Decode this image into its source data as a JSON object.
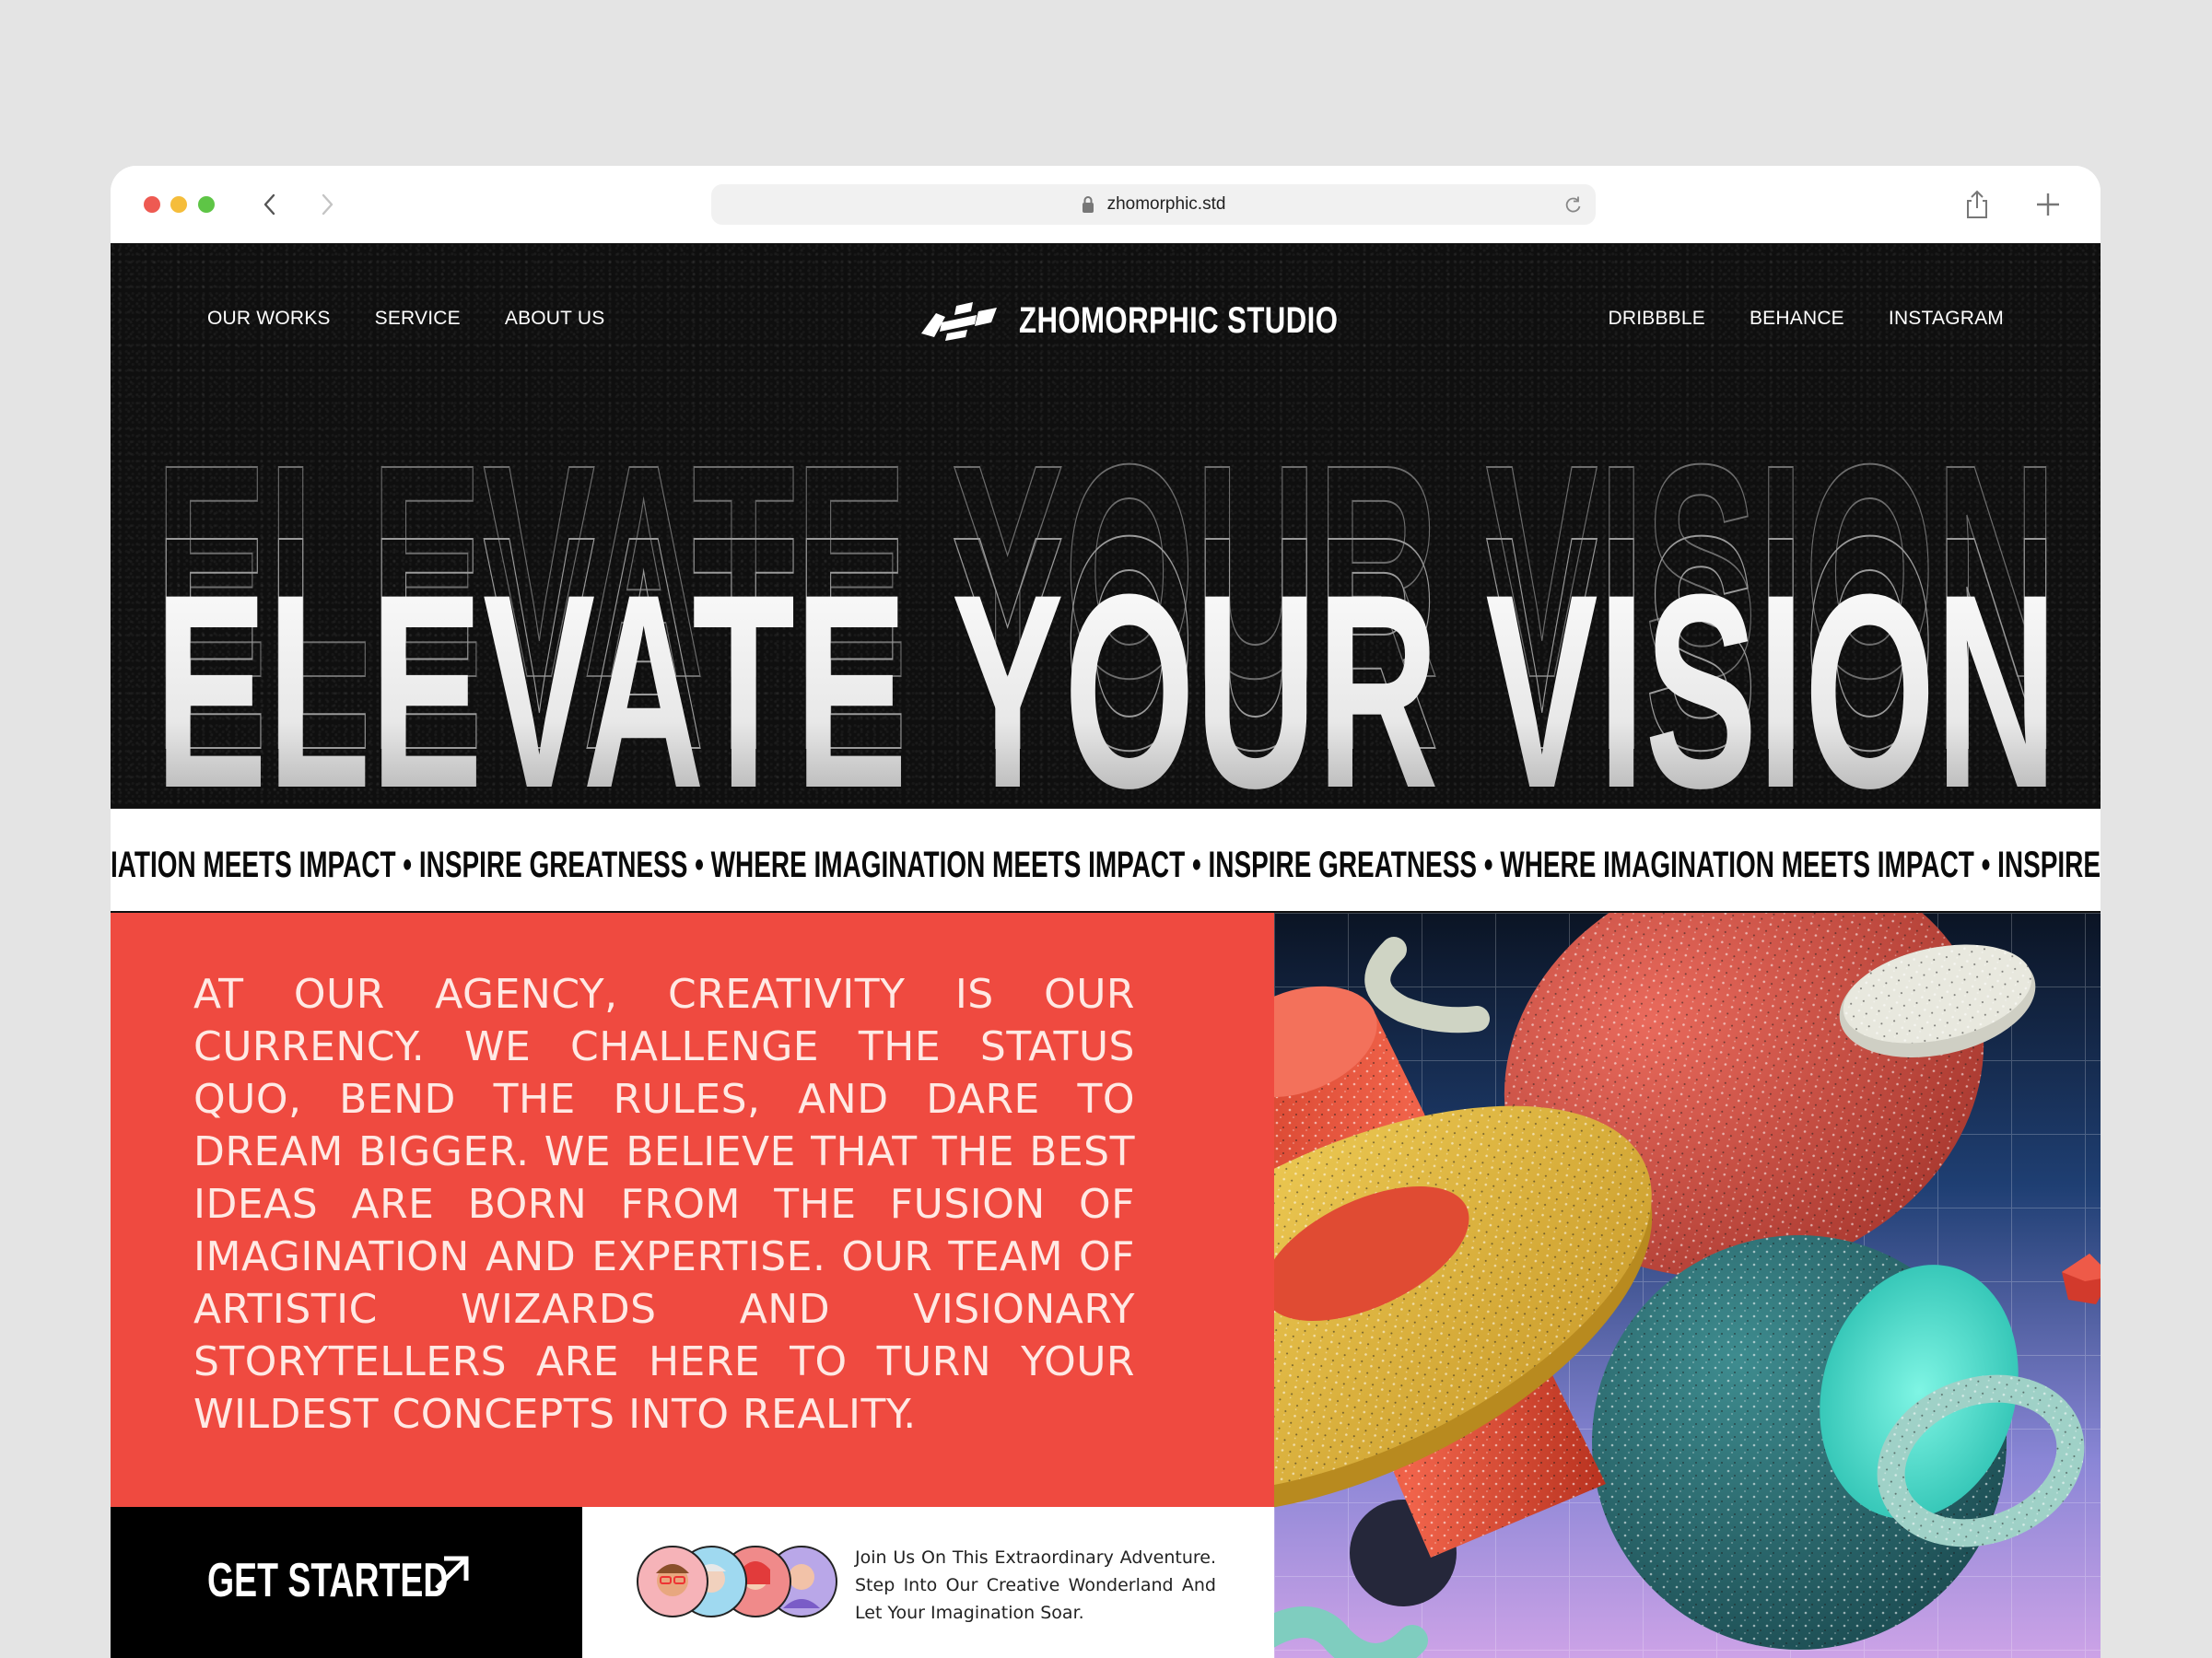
{
  "browser": {
    "url": "zhomorphic.std"
  },
  "nav": {
    "left": [
      "OUR WORKS",
      "SERVICE",
      "ABOUT US"
    ],
    "brand": "ZHOMORPHIC STUDIO",
    "right": [
      "DRIBBBLE",
      "BEHANCE",
      "INSTAGRAM"
    ]
  },
  "hero": {
    "headline": "ELEVATE YOUR VISION"
  },
  "marquee": {
    "text": "IATION MEETS IMPACT  •  INSPIRE GREATNESS  •  WHERE IMAGINATION MEETS IMPACT  •  INSPIRE GREATNESS  •  WHERE IMAGINATION MEETS IMPACT  •  INSPIRE"
  },
  "about": {
    "mission": "AT OUR AGENCY, CREATIVITY IS OUR CURRENCY. WE CHALLENGE THE STATUS QUO, BEND THE RULES, AND DARE TO DREAM BIGGER. WE BELIEVE THAT THE BEST IDEAS ARE BORN FROM THE FUSION OF IMAGINATION AND EXPERTISE. OUR TEAM OF ARTISTIC WIZARDS AND VISIONARY STORYTELLERS ARE HERE TO TURN YOUR WILDEST CONCEPTS INTO REALITY."
  },
  "cta": {
    "label": "GET STARTED",
    "join_text": "Join Us On This Extraordinary Adventure. Step Into Our Creative Wonderland And Let Your Imagination Soar."
  },
  "colors": {
    "accent_red": "#ef4a40",
    "dark": "#0f0f0f",
    "white": "#ffffff"
  }
}
